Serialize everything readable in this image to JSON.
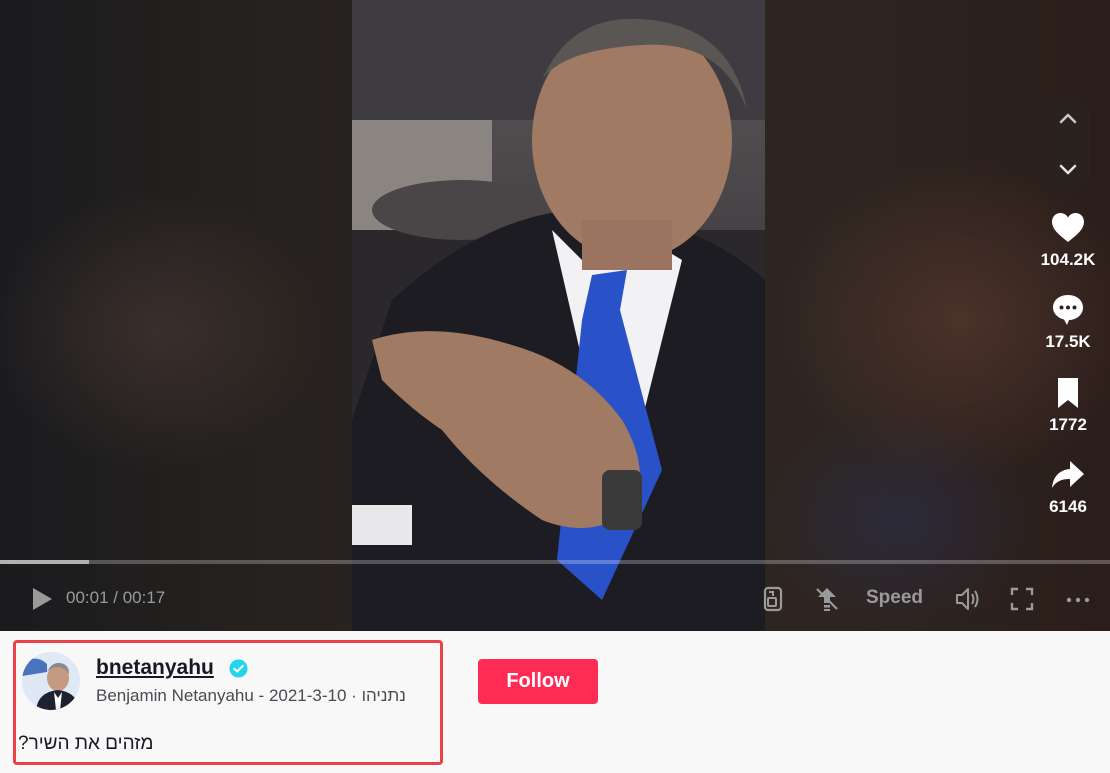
{
  "player": {
    "progress_fraction": 0.08,
    "time_current": "00:01",
    "time_separator": " / ",
    "time_total": "00:17",
    "speed_label": "Speed"
  },
  "actions": [
    {
      "icon": "heart-icon",
      "count": "104.2K"
    },
    {
      "icon": "comment-icon",
      "count": "17.5K"
    },
    {
      "icon": "bookmark-icon",
      "count": "1772"
    },
    {
      "icon": "share-icon",
      "count": "6146"
    }
  ],
  "author": {
    "username": "bnetanyahu",
    "display_name": "Benjamin Netanyahu - נתניהו",
    "separator": " · ",
    "date": "2021-3-10",
    "verified": true
  },
  "caption": "מזהים את השיר?",
  "follow_label": "Follow",
  "colors": {
    "follow": "#fe2c55",
    "verified": "#20d5ec",
    "highlight_border": "#e8434a"
  }
}
